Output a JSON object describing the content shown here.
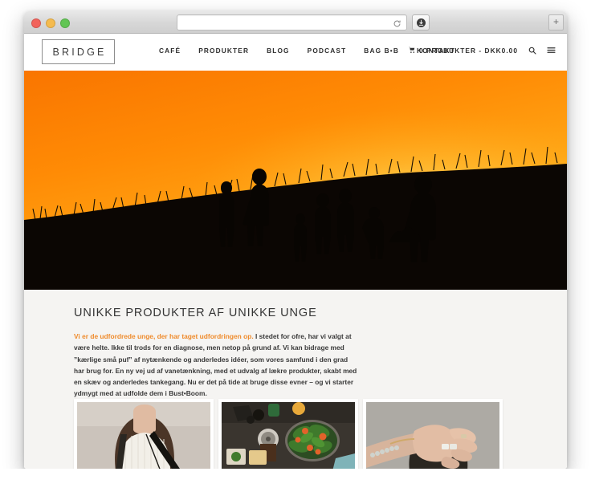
{
  "browser": {
    "traffic_lights": [
      "close",
      "minimize",
      "maximize"
    ],
    "address_value": "",
    "address_placeholder": "",
    "reload_label": "Reload",
    "download_label": "Downloads",
    "newtab_label": "+"
  },
  "site": {
    "logo_text": "BRIDGE",
    "nav": [
      {
        "label": "CAFÉ"
      },
      {
        "label": "PRODUKTER"
      },
      {
        "label": "BLOG"
      },
      {
        "label": "PODCAST"
      },
      {
        "label": "BAG B•B"
      },
      {
        "label": "KONTAKT"
      }
    ],
    "cart": {
      "icon": "cart-icon",
      "label": "0 PRODUKTER - DKK0.00"
    },
    "icons": {
      "search": "search-icon",
      "menu": "hamburger-menu-icon"
    }
  },
  "hero": {
    "alt": "Silhouettes of a group of young people standing on a grassy hill against an orange sunset sky",
    "sky_top_color": "#ff8a00",
    "sky_glow_color": "#ffc93c",
    "ground_color": "#0a0603"
  },
  "main": {
    "heading": "UNIKKE PRODUKTER AF UNIKKE UNGE",
    "lead_sentence": "Vi er de udfordrede unge, der har taget udfordringen op.",
    "body_text": " I stedet for ofre, har vi valgt at være helte. Ikke til trods for en diagnose, men netop på grund af. Vi kan bidrage med ”kærlige små puf” af nytænkende og anderledes idéer, som vores samfund i den grad har brug for. En ny vej ud af vanetænkning, med et udvalg af lækre produkter, skabt med en skæv og anderledes tankegang. Nu er det på tide at bruge disse evner – og vi starter ydmygt med at udfolde dem i Bust•Boom.",
    "accent_color": "#ef8b2c"
  },
  "thumbnails": [
    {
      "alt": "Young person with long brown hair in a white knit sweater wearing a black bag strap"
    },
    {
      "alt": "Top-down view of a dark table with a glass bowl of green salad with tomatoes"
    },
    {
      "alt": "A hand with rings and bracelets raised against a grey background"
    }
  ]
}
